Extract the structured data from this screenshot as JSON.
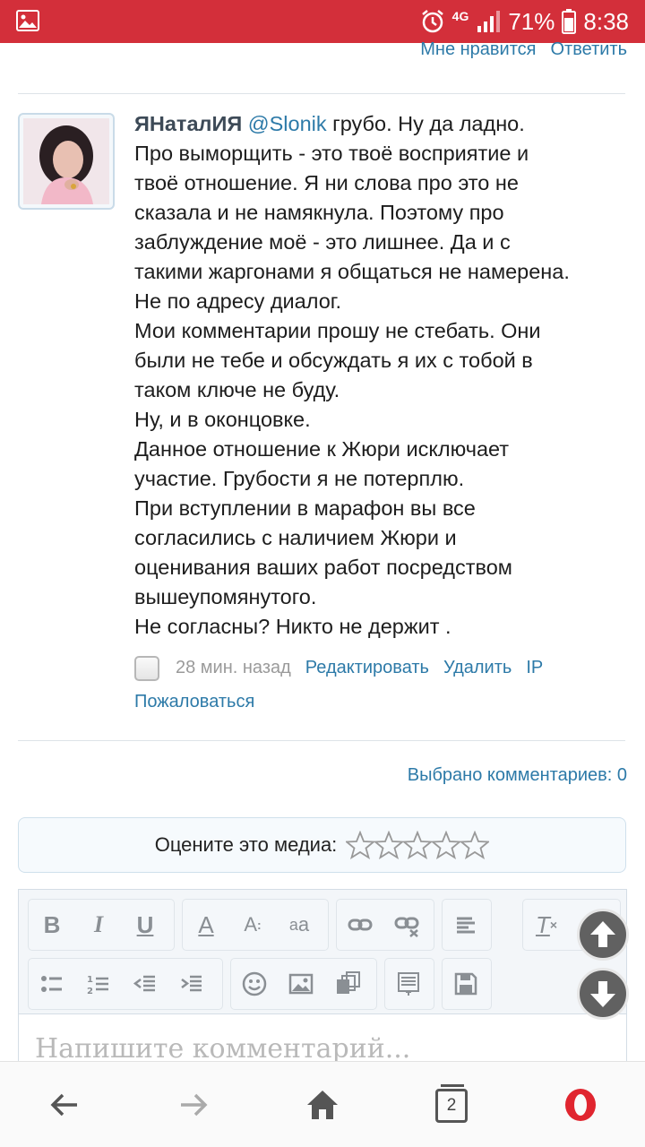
{
  "status_bar": {
    "network": "4G",
    "battery_percent": "71%",
    "time": "8:38",
    "bg_color": "#d32f3a"
  },
  "top_actions": {
    "like": "Мне нравится",
    "reply": "Ответить"
  },
  "comment": {
    "author": "ЯНаталИЯ",
    "mention": "@Slonik",
    "first_line_rest": " грубо. Ну да ладно.",
    "lines": [
      "Про выморщить - это твоё восприятие и",
      "твоё отношение. Я ни слова про это не",
      "сказала и не намякнула. Поэтому про",
      "заблуждение моё - это лишнее. Да и с",
      "такими жаргонами я общаться не намерена.",
      "Не по адресу диалог.",
      "Мои комментарии прошу не стебать. Они",
      "были не тебе и обсуждать я их с тобой в",
      "таком ключе не буду.",
      "Ну, и в оконцовке.",
      "Данное отношение к Жюри исключает",
      "участие. Грубости я не потерплю.",
      "При вступлении в марафон вы все",
      "согласились с наличием Жюри и",
      "оценивания ваших работ посредством",
      "вышеупомянутого.",
      "Не согласны? Никто не держит ."
    ],
    "time_ago": "28 мин. назад",
    "edit": "Редактировать",
    "delete": "Удалить",
    "ip": "IP",
    "report": "Пожаловаться"
  },
  "selected_comments": "Выбрано комментариев: 0",
  "rating": {
    "label": "Оцените это медиа:",
    "stars_total": 5,
    "stars_filled": 0
  },
  "editor": {
    "placeholder": "Напишите комментарий...",
    "toolbar_row1": [
      "bold",
      "italic",
      "underline",
      "font-color",
      "font-size",
      "subscript",
      "link",
      "unlink",
      "align",
      "clear-format"
    ],
    "toolbar_row2": [
      "bulleted-list",
      "numbered-list",
      "outdent",
      "indent",
      "smiley",
      "image",
      "media",
      "template",
      "save"
    ],
    "bold_glyph": "B",
    "italic_glyph": "I",
    "underline_glyph": "U",
    "font_color_glyph": "A",
    "font_size_glyph": "A",
    "subscript_glyph": "a",
    "clear_glyph": "T"
  },
  "bottom_nav": {
    "tabs_count": "2",
    "browser": "opera"
  },
  "colors": {
    "link": "#2d7aa8",
    "accent_red": "#d32f3a"
  }
}
